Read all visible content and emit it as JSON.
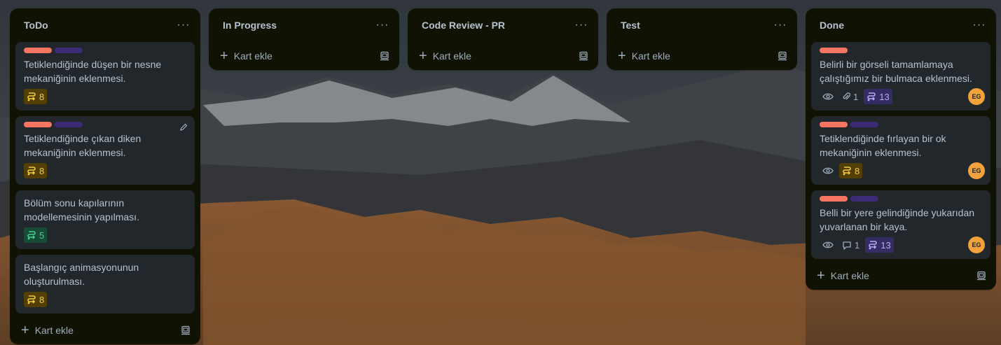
{
  "colors": {
    "label_red": "#f87462",
    "label_purple": "#3d2b78",
    "list_bg": "#101204",
    "card_bg": "#22272b",
    "avatar_bg": "#f2a23a"
  },
  "add_card_label": "Kart ekle",
  "menu_icon": "more-dots",
  "lists": [
    {
      "title": "ToDo",
      "cards": [
        {
          "title": "Tetiklendiğinde düşen bir nesne mekaniğinin eklenmesi.",
          "labels": [
            "red",
            "purple"
          ],
          "points": "8",
          "points_color": "yellow"
        },
        {
          "title": "Tetiklendiğinde çıkan diken mekaniğinin eklenmesi.",
          "labels": [
            "red",
            "purple"
          ],
          "points": "8",
          "points_color": "yellow",
          "edit_icon": "pencil-icon"
        },
        {
          "title": "Bölüm sonu kapılarının modellemesinin yapılması.",
          "points": "5",
          "points_color": "green"
        },
        {
          "title": "Başlangıç animasyonunun oluşturulması.",
          "points": "8",
          "points_color": "yellow"
        }
      ]
    },
    {
      "title": "In Progress",
      "cards": []
    },
    {
      "title": "Code Review - PR",
      "cards": []
    },
    {
      "title": "Test",
      "cards": []
    },
    {
      "title": "Done",
      "cards": [
        {
          "title": "Belirli bir görseli tamamlamaya çalıştığımız bir bulmaca eklenmesi.",
          "labels": [
            "red"
          ],
          "watch": true,
          "attachments": "1",
          "points": "13",
          "points_color": "purple",
          "avatar": "EG"
        },
        {
          "title": "Tetiklendiğinde fırlayan bir ok mekaniğinin eklenmesi.",
          "labels": [
            "red",
            "purple"
          ],
          "watch": true,
          "points": "8",
          "points_color": "yellow",
          "avatar": "EG"
        },
        {
          "title": "Belli bir yere gelindiğinde yukarıdan yuvarlanan bir kaya.",
          "labels": [
            "red",
            "purple"
          ],
          "watch": true,
          "comments": "1",
          "points": "13",
          "points_color": "purple",
          "avatar": "EG"
        }
      ]
    }
  ]
}
